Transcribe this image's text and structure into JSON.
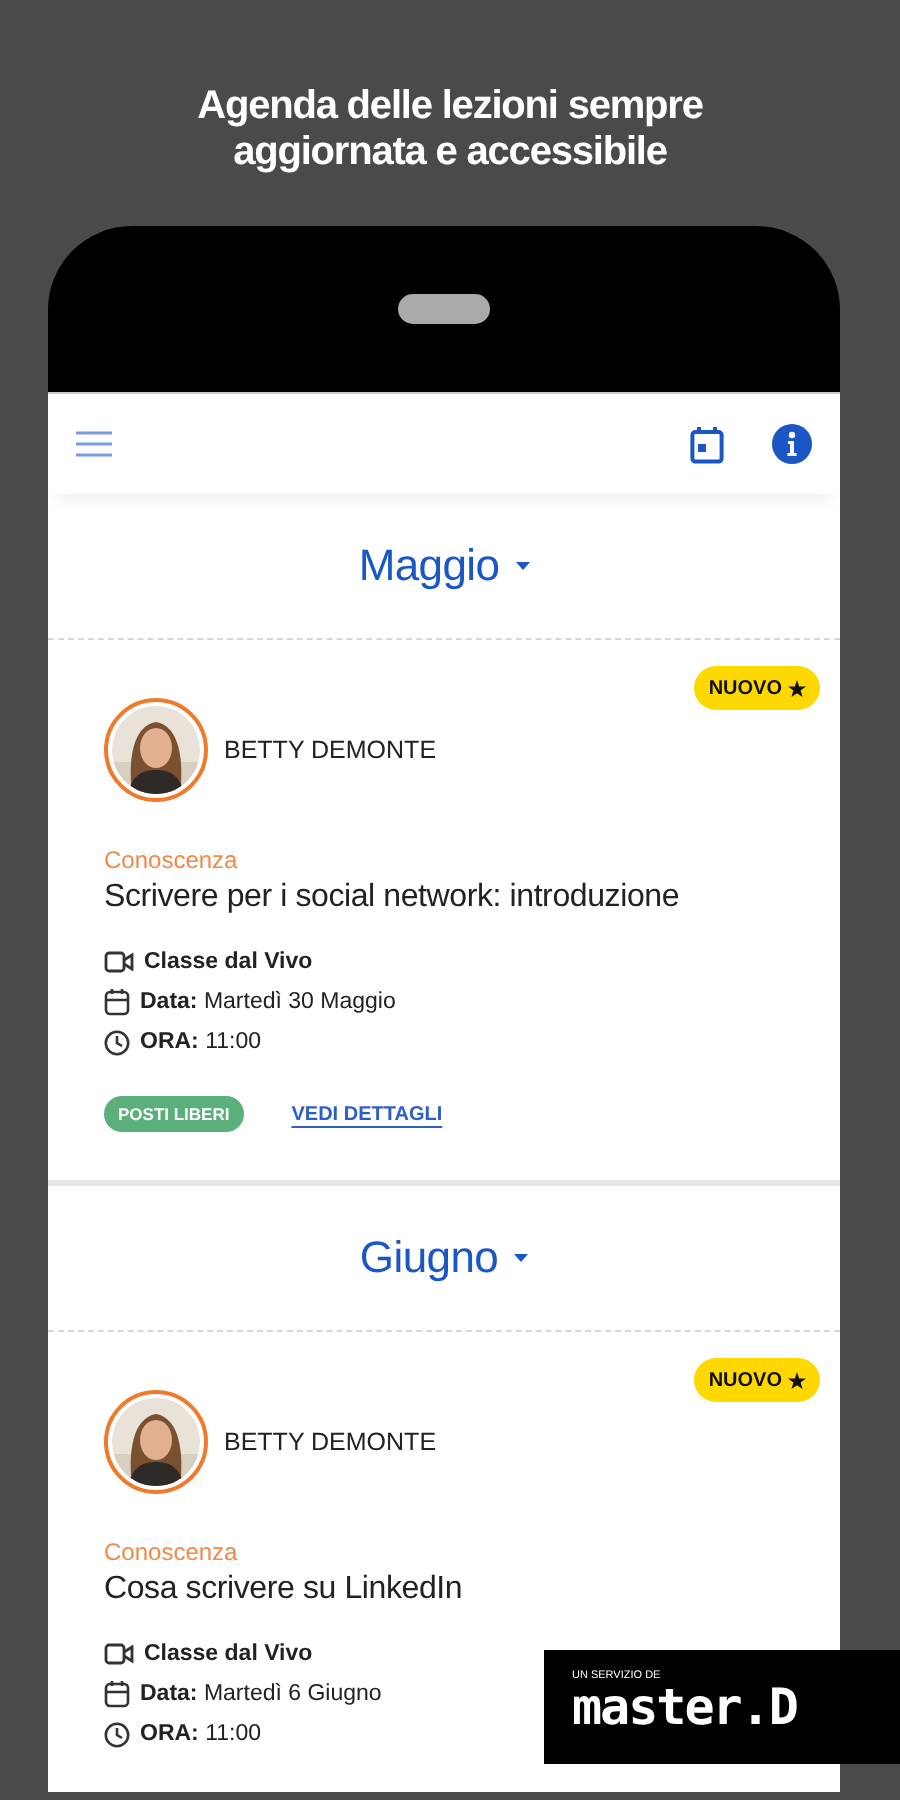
{
  "headline": "Agenda delle lezioni sempre aggiornata e accessibile",
  "sections": [
    {
      "month": "Maggio",
      "lessons": [
        {
          "badge": "NUOVO",
          "teacher": "BETTY DEMONTE",
          "category": "Conoscenza",
          "title": "Scrivere per i social network: introduzione",
          "mode": "Classe dal Vivo",
          "date": "**Data:** Martedì 30 Maggio",
          "time": "**ORA:** 11:00",
          "availability": "POSTI LIBERI",
          "link": "VEDI DETTAGLI"
        }
      ]
    },
    {
      "month": "Giugno",
      "lessons": [
        {
          "badge": "NUOVO",
          "teacher": "BETTY DEMONTE",
          "category": "Conoscenza",
          "title": "Cosa scrivere su LinkedIn",
          "mode": "Classe dal Vivo",
          "date": "**Data:** Martedì 6 Giugno",
          "time": "**ORA:** 11:00"
        }
      ]
    }
  ],
  "logo": {
    "tagline": "UN SERVIZIO DE",
    "name": "master.D"
  }
}
